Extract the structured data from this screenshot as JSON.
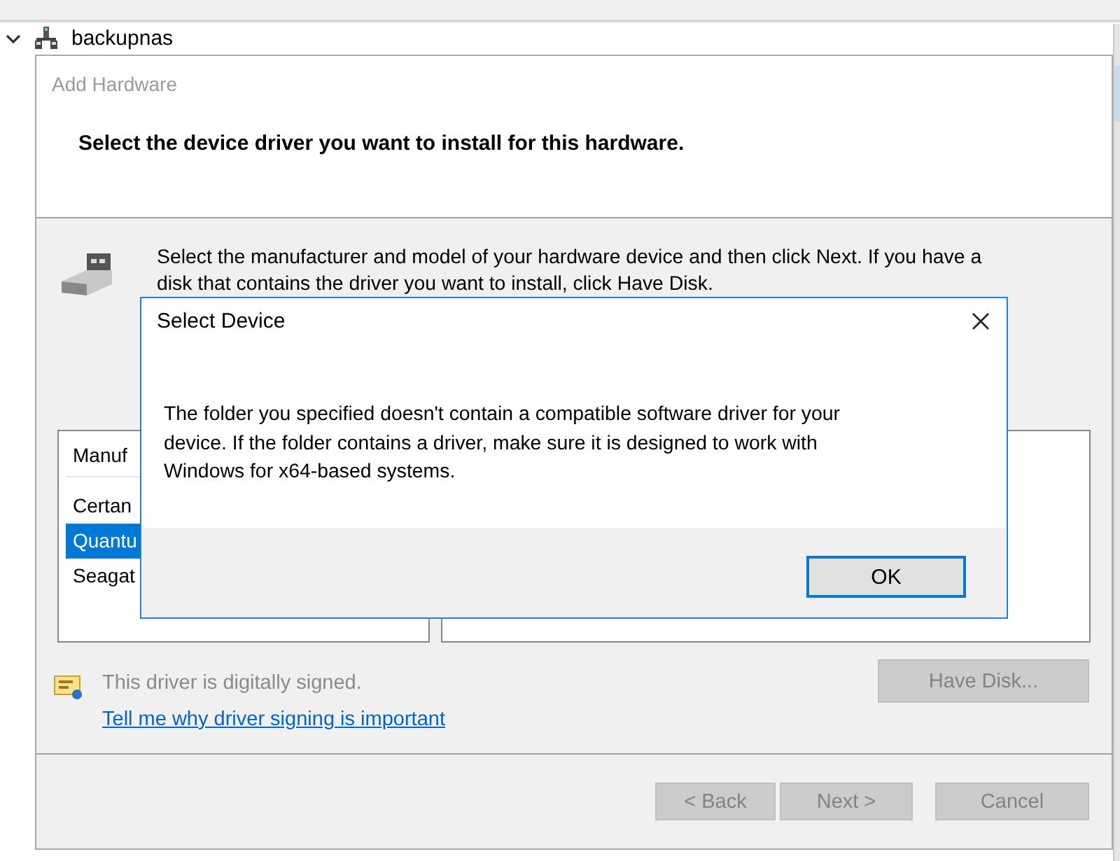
{
  "tree_item": {
    "label": "backupnas",
    "expanded": true
  },
  "wizard": {
    "title": "Add Hardware",
    "heading": "Select the device driver you want to install for this hardware.",
    "instructions": [
      "Select the manufacturer and model of your hardware device and then click Next. If you have a",
      "disk that contains the driver you want to install, click Have Disk."
    ],
    "manufacturer_list": {
      "header": "Manuf",
      "items": [
        {
          "label": "Certan",
          "selected": false
        },
        {
          "label": "Quantu",
          "selected": true
        },
        {
          "label": "Seagat",
          "selected": false
        }
      ]
    },
    "signing_status": "This driver is digitally signed.",
    "signing_link": "Tell me why driver signing is important",
    "have_disk_button": {
      "label": "Have Disk...",
      "disabled": true
    },
    "buttons": [
      {
        "label": "< Back",
        "disabled": true
      },
      {
        "label": "Next >",
        "disabled": true
      },
      {
        "label": "Cancel",
        "disabled": true
      }
    ]
  },
  "dialog": {
    "title": "Select Device",
    "message": [
      "The folder you specified doesn't contain a compatible software driver for your",
      "device. If the folder contains a driver, make sure it is designed to work with",
      "Windows for x64-based systems."
    ],
    "ok_button": {
      "label": "OK",
      "default": true
    }
  }
}
